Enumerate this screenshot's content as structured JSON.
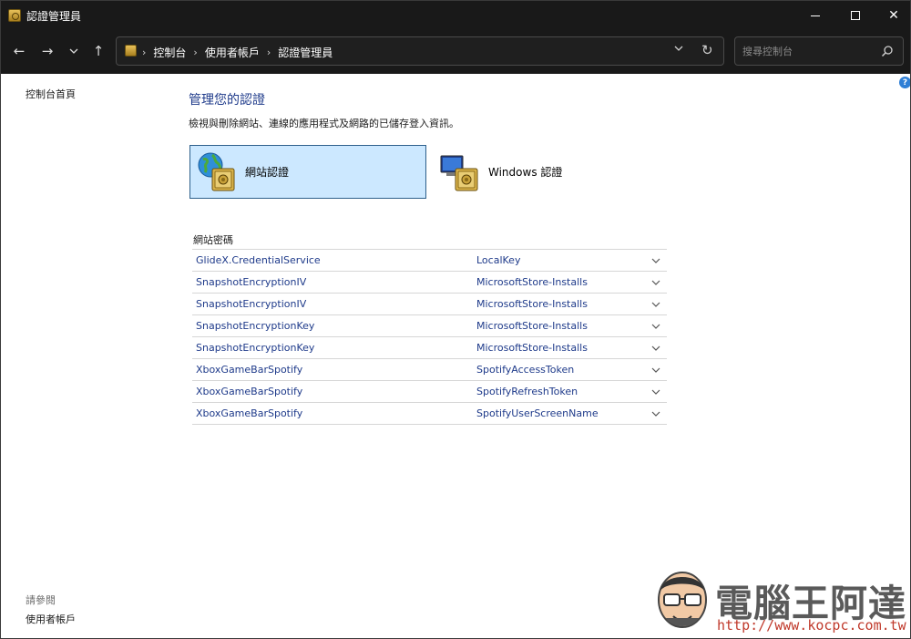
{
  "window": {
    "title": "認證管理員",
    "minimize_label": "",
    "maximize_label": "",
    "close_label": "✕"
  },
  "nav": {
    "back_icon": "arrow-left-icon",
    "forward_icon": "arrow-right-icon",
    "recent_icon": "chevron-down-icon",
    "up_icon": "arrow-up-icon",
    "back_glyph": "←",
    "forward_glyph": "→",
    "recent_glyph": "⌄",
    "up_glyph": "↑",
    "refresh_glyph": "↻",
    "dropdown_glyph": "⌄"
  },
  "address": {
    "breadcrumbs": [
      "控制台",
      "使用者帳戶",
      "認證管理員"
    ],
    "separator": "›"
  },
  "search": {
    "placeholder": "搜尋控制台",
    "value": ""
  },
  "sidebar": {
    "home_link": "控制台首頁",
    "see_also": "請參閱",
    "user_accounts_link": "使用者帳戶"
  },
  "help": {
    "label": "?"
  },
  "main": {
    "heading": "管理您的認證",
    "subtext": "檢視與刪除網站、連線的應用程式及網路的已儲存登入資訊。",
    "tiles": {
      "web": "網站認證",
      "windows": "Windows 認證"
    },
    "section_label": "網站密碼",
    "credentials": [
      {
        "name": "GlideX.CredentialService",
        "user": "LocalKey"
      },
      {
        "name": "SnapshotEncryptionIV",
        "user": "MicrosoftStore-Installs"
      },
      {
        "name": "SnapshotEncryptionIV",
        "user": "MicrosoftStore-Installs"
      },
      {
        "name": "SnapshotEncryptionKey",
        "user": "MicrosoftStore-Installs"
      },
      {
        "name": "SnapshotEncryptionKey",
        "user": "MicrosoftStore-Installs"
      },
      {
        "name": "XboxGameBarSpotify",
        "user": "SpotifyAccessToken"
      },
      {
        "name": "XboxGameBarSpotify",
        "user": "SpotifyRefreshToken"
      },
      {
        "name": "XboxGameBarSpotify",
        "user": "SpotifyUserScreenName"
      }
    ]
  },
  "watermark": {
    "brand": "電腦王阿達",
    "url": "http://www.kocpc.com.tw"
  },
  "colors": {
    "titlebar": "#191919",
    "selected_tile": "#cce8ff",
    "link_blue": "#1e3a8a",
    "watermark_url": "#c0392b"
  }
}
